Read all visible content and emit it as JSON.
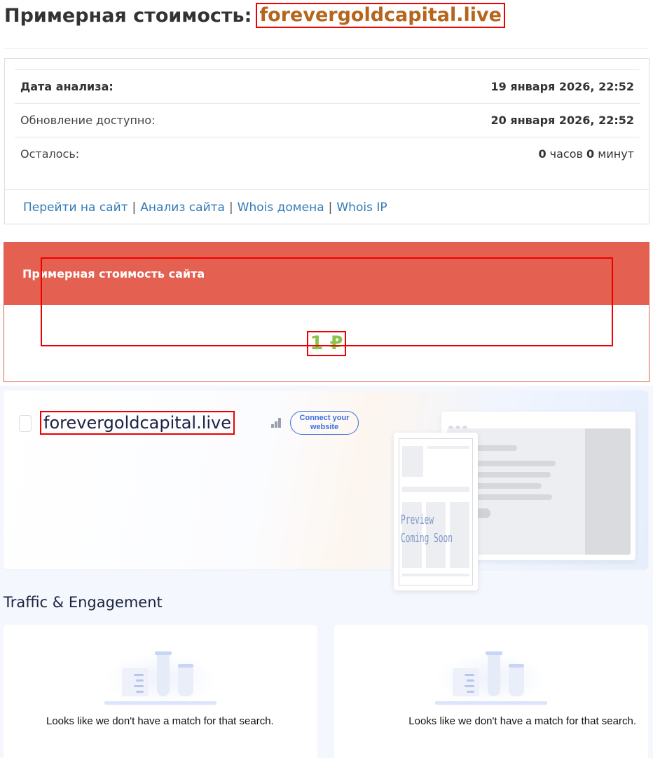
{
  "header": {
    "title_prefix": "Примерная стоимость:",
    "domain": "forevergoldcapital.live"
  },
  "info": {
    "rows": [
      {
        "label": "Дата анализа:",
        "value": "19 января 2026, 22:52"
      },
      {
        "label": "Обновление доступно:",
        "value": "20 января 2026, 22:52"
      },
      {
        "label": "Осталось:",
        "hours": "0",
        "hours_unit": "часов",
        "minutes": "0",
        "minutes_unit": "минут"
      }
    ],
    "links": [
      "Перейти на сайт",
      "Анализ сайта",
      "Whois домена",
      "Whois IP"
    ],
    "link_separator": "|"
  },
  "cost_panel": {
    "heading": "Примерная стоимость сайта",
    "value": "1 ₽",
    "colors": {
      "header": "#e46050",
      "value": "#8bc34a"
    }
  },
  "similarweb": {
    "domain": "forevergoldcapital.live",
    "connect_label": "Connect your website",
    "preview_text_line1": "Preview",
    "preview_text_line2": "Coming Soon",
    "section_title": "Traffic & Engagement",
    "empty_message_left": "Looks like we don't have a match for that search.",
    "empty_message_right": "Looks like we don't have a match for that search."
  }
}
